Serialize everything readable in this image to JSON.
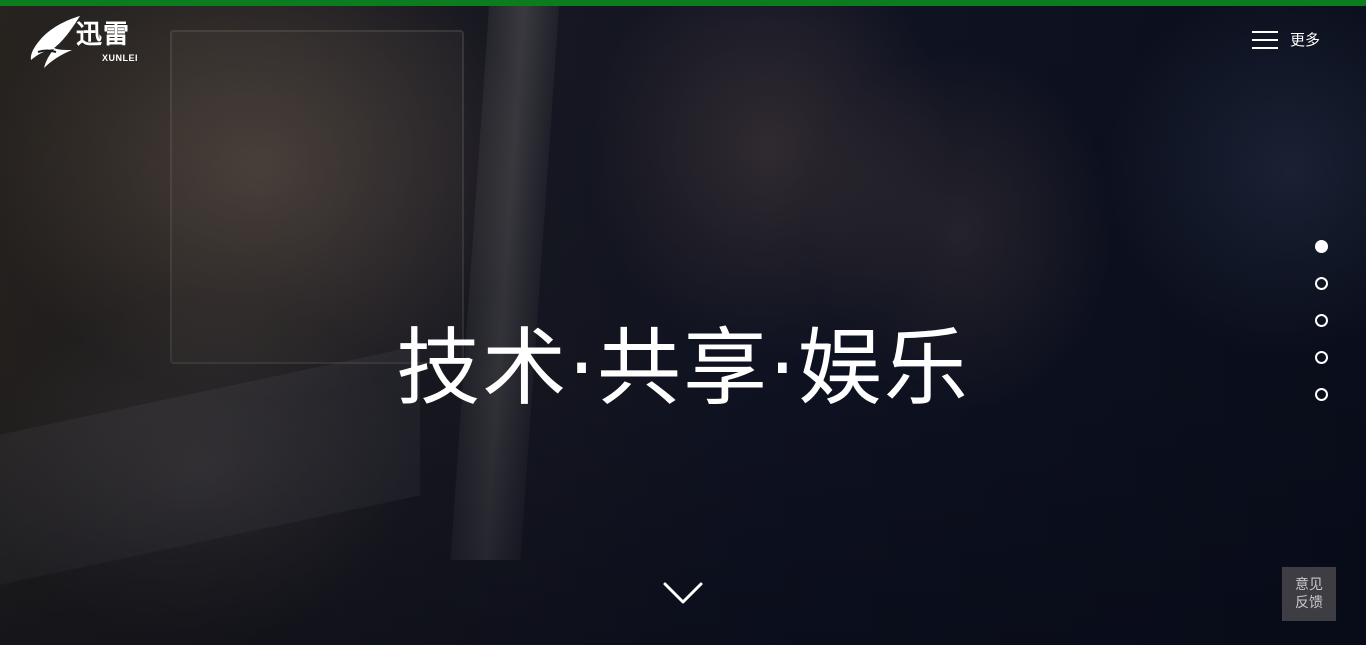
{
  "header": {
    "logo_text": "迅雷",
    "logo_sub": "XUNLEI",
    "more_label": "更多"
  },
  "hero": {
    "slogan": "技术·共享·娱乐",
    "slides": [
      {
        "active": true
      },
      {
        "active": false
      },
      {
        "active": false
      },
      {
        "active": false
      },
      {
        "active": false
      }
    ]
  },
  "feedback": {
    "line1": "意见",
    "line2": "反馈"
  },
  "colors": {
    "top_bar": "#0b7d1f",
    "text": "#ffffff"
  },
  "icons": {
    "logo": "xunlei-bird-logo-icon",
    "menu": "hamburger-menu-icon",
    "scroll": "chevron-down-icon"
  }
}
